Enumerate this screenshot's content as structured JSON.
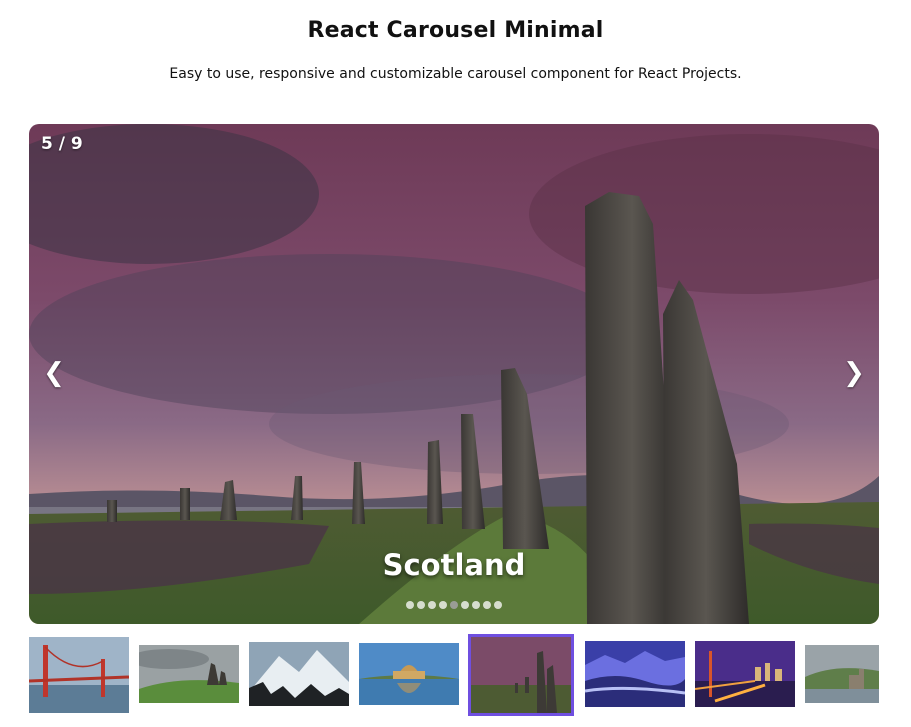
{
  "header": {
    "title": "React Carousel Minimal",
    "subtitle": "Easy to use, responsive and customizable carousel component for React Projects."
  },
  "carousel": {
    "counter": "5 / 9",
    "current_caption": "Scotland",
    "prev_icon": "❮",
    "next_icon": "❯",
    "dot_count": 9,
    "active_dot": 5
  },
  "thumbnails": [
    {
      "icon": "golden-gate-bridge-thumb"
    },
    {
      "icon": "green-hills-thumb"
    },
    {
      "icon": "snowy-mountain-thumb"
    },
    {
      "icon": "palace-of-fine-arts-thumb"
    },
    {
      "icon": "standing-stones-thumb",
      "selected": true
    },
    {
      "icon": "blue-mountains-thumb"
    },
    {
      "icon": "night-city-bridge-thumb"
    },
    {
      "icon": "castle-lake-thumb"
    }
  ],
  "colors": {
    "selected_thumb_border": "#6f4fe0",
    "caption_text": "#ffffff"
  }
}
